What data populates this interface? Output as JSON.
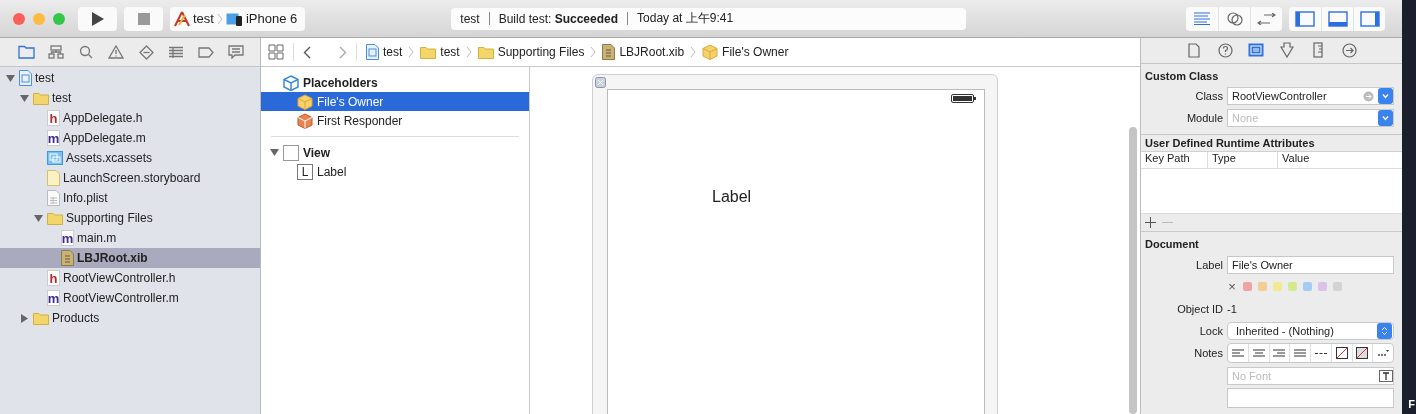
{
  "toolbar": {
    "scheme": {
      "target": "test",
      "device": "iPhone 6"
    },
    "activity": {
      "project": "test",
      "status": "Build test: **Succeeded**",
      "time": "Today at 上午9:41"
    },
    "editor_modes": [
      {
        "kind": "standard",
        "selected": true
      },
      {
        "kind": "assistant",
        "selected": false
      },
      {
        "kind": "version",
        "selected": false
      }
    ],
    "panels": [
      {
        "kind": "navigator",
        "selected": true
      },
      {
        "kind": "debug",
        "selected": true
      },
      {
        "kind": "utilities",
        "selected": true
      }
    ]
  },
  "navigator": {
    "tabs": [
      {
        "kind": "project",
        "selected": true
      },
      {
        "kind": "symbol",
        "selected": false
      },
      {
        "kind": "find",
        "selected": false
      },
      {
        "kind": "issue",
        "selected": false
      },
      {
        "kind": "test",
        "selected": false
      },
      {
        "kind": "debug",
        "selected": false
      },
      {
        "kind": "breakpoint",
        "selected": false
      },
      {
        "kind": "report",
        "selected": false
      }
    ],
    "tree": [
      {
        "name": "test",
        "kind": "project",
        "expanded": true,
        "selected": false,
        "children": [
          {
            "name": "test",
            "kind": "folder",
            "expanded": true,
            "selected": false,
            "children": [
              {
                "name": "AppDelegate.h",
                "kind": "header",
                "icon_letter": "h",
                "selected": false
              },
              {
                "name": "AppDelegate.m",
                "kind": "source",
                "icon_letter": "m",
                "selected": false
              },
              {
                "name": "Assets.xcassets",
                "kind": "assets",
                "selected": false
              },
              {
                "name": "LaunchScreen.storyboard",
                "kind": "storyboard",
                "selected": false
              },
              {
                "name": "Info.plist",
                "kind": "plist",
                "selected": false
              },
              {
                "name": "Supporting Files",
                "kind": "folder",
                "expanded": true,
                "selected": false,
                "children": [
                  {
                    "name": "main.m",
                    "kind": "source",
                    "icon_letter": "m",
                    "selected": false
                  },
                  {
                    "name": "LBJRoot.xib",
                    "kind": "xib",
                    "selected": true
                  }
                ]
              },
              {
                "name": "RootViewController.h",
                "kind": "header",
                "icon_letter": "h",
                "selected": false
              },
              {
                "name": "RootViewController.m",
                "kind": "source",
                "icon_letter": "m",
                "selected": false
              }
            ]
          },
          {
            "name": "Products",
            "kind": "folder",
            "expanded": false,
            "selected": false
          }
        ]
      }
    ]
  },
  "jump_bar": {
    "path": [
      {
        "label": "test",
        "kind": "project"
      },
      {
        "label": "test",
        "kind": "folder"
      },
      {
        "label": "Supporting Files",
        "kind": "folder"
      },
      {
        "label": "LBJRoot.xib",
        "kind": "xib"
      },
      {
        "label": "File's Owner",
        "kind": "owner"
      }
    ]
  },
  "outline": {
    "sections": [
      {
        "label": "Placeholders",
        "kind": "placeholders",
        "items": [
          {
            "label": "File's Owner",
            "kind": "owner",
            "selected": true
          },
          {
            "label": "First Responder",
            "kind": "responder",
            "selected": false
          }
        ]
      },
      {
        "label": "View",
        "kind": "view",
        "expanded": true,
        "items": [
          {
            "label": "Label",
            "kind": "label",
            "icon_letter": "L",
            "selected": false
          }
        ]
      }
    ]
  },
  "canvas": {
    "label": "Label"
  },
  "inspector": {
    "tabs": [
      {
        "kind": "file",
        "selected": false
      },
      {
        "kind": "help",
        "selected": false
      },
      {
        "kind": "identity",
        "selected": true
      },
      {
        "kind": "attributes",
        "selected": false
      },
      {
        "kind": "size",
        "selected": false
      },
      {
        "kind": "connections",
        "selected": false
      }
    ],
    "custom_class": {
      "title": "Custom Class",
      "class_label": "Class",
      "class_value": "RootViewController",
      "module_label": "Module",
      "module_placeholder": "None"
    },
    "runtime_attributes": {
      "title": "User Defined Runtime Attributes",
      "columns": [
        "Key Path",
        "Type",
        "Value"
      ]
    },
    "document": {
      "title": "Document",
      "label_label": "Label",
      "label_value": "File's Owner",
      "clear_mark": "×",
      "colors": [
        {
          "color": "#f0a3a3"
        },
        {
          "color": "#f4cd92"
        },
        {
          "color": "#f1ea92"
        },
        {
          "color": "#d6e98f"
        },
        {
          "color": "#a3cdf2"
        },
        {
          "color": "#dcc2ea"
        },
        {
          "color": "#d3d3d3"
        }
      ],
      "object_id_label": "Object ID",
      "object_id": "-1",
      "lock_label": "Lock",
      "lock_value": "Inherited - (Nothing)",
      "notes_label": "Notes",
      "font_placeholder": "No Font"
    }
  },
  "desktop": {
    "text": "F"
  }
}
